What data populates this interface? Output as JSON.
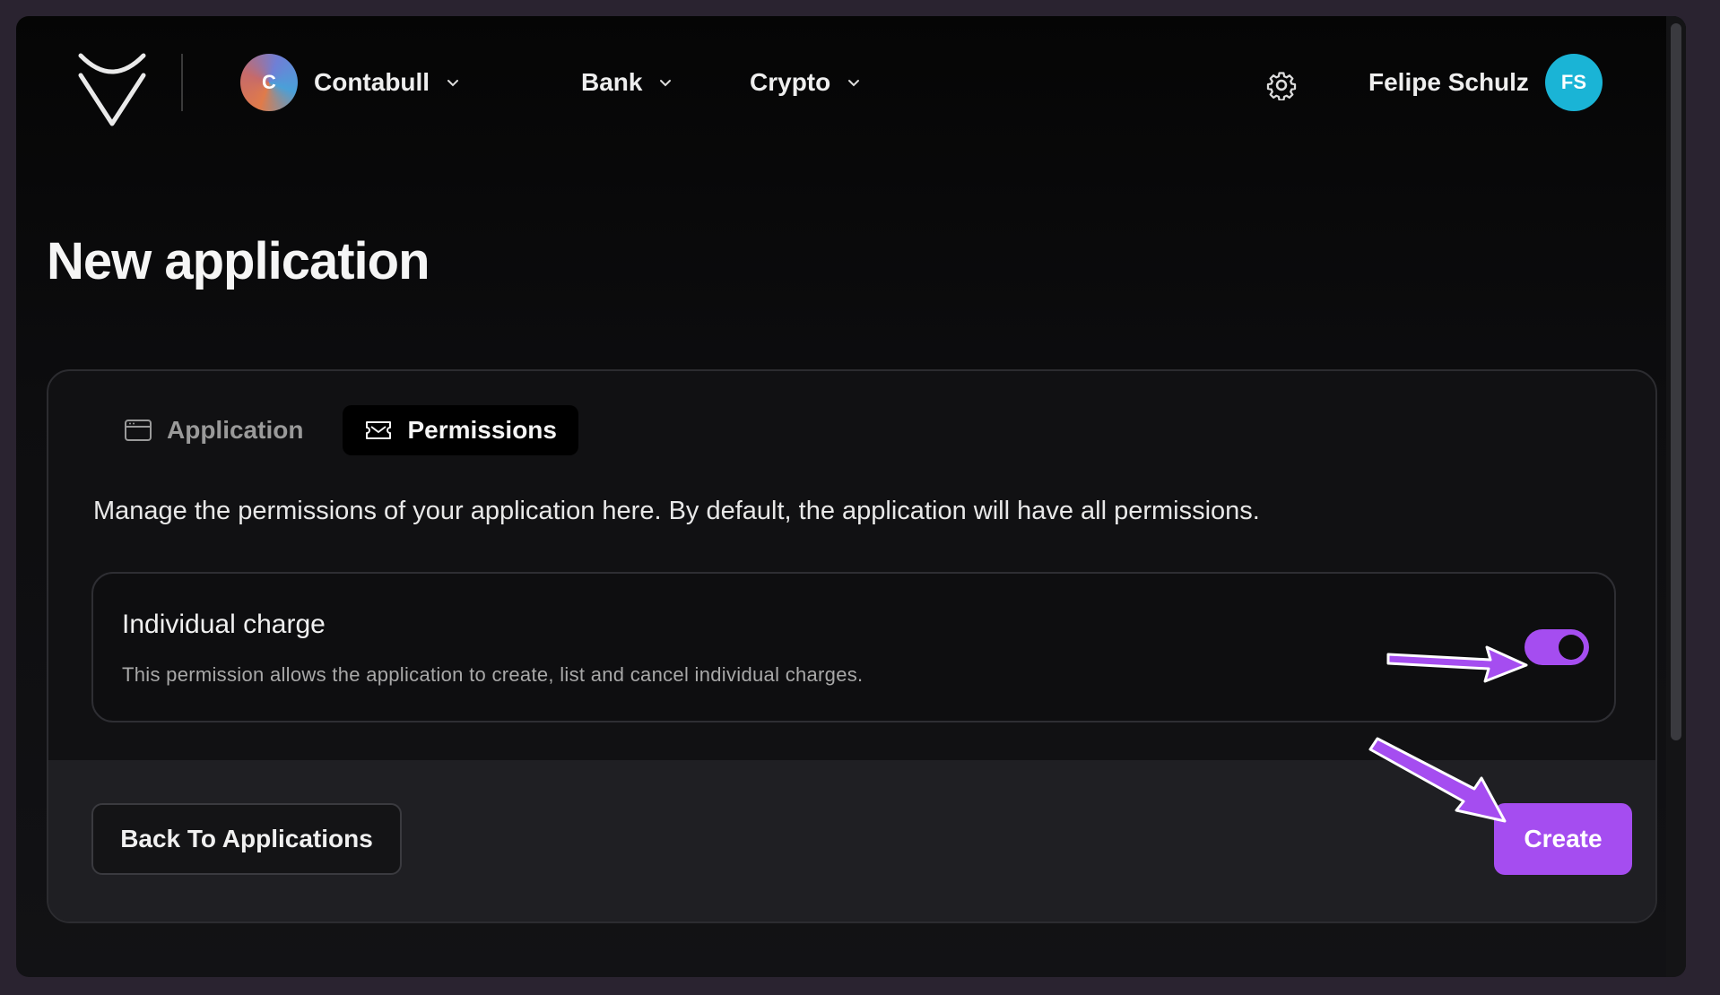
{
  "header": {
    "org": {
      "initial": "C",
      "name": "Contabull"
    },
    "nav": [
      {
        "label": "Bank"
      },
      {
        "label": "Crypto"
      }
    ],
    "user": {
      "name": "Felipe Schulz",
      "initials": "FS"
    }
  },
  "page": {
    "title": "New application"
  },
  "tabs": [
    {
      "label": "Application",
      "icon": "window-icon",
      "active": false
    },
    {
      "label": "Permissions",
      "icon": "ticket-icon",
      "active": true
    }
  ],
  "permissions": {
    "description": "Manage the permissions of your application here. By default, the application will have all permissions.",
    "items": [
      {
        "title": "Individual charge",
        "description": "This permission allows the application to create, list and cancel individual charges.",
        "enabled": true
      }
    ]
  },
  "footer": {
    "back_label": "Back To Applications",
    "create_label": "Create"
  },
  "colors": {
    "accent": "#a54df0",
    "user_avatar": "#1ab4d6"
  }
}
